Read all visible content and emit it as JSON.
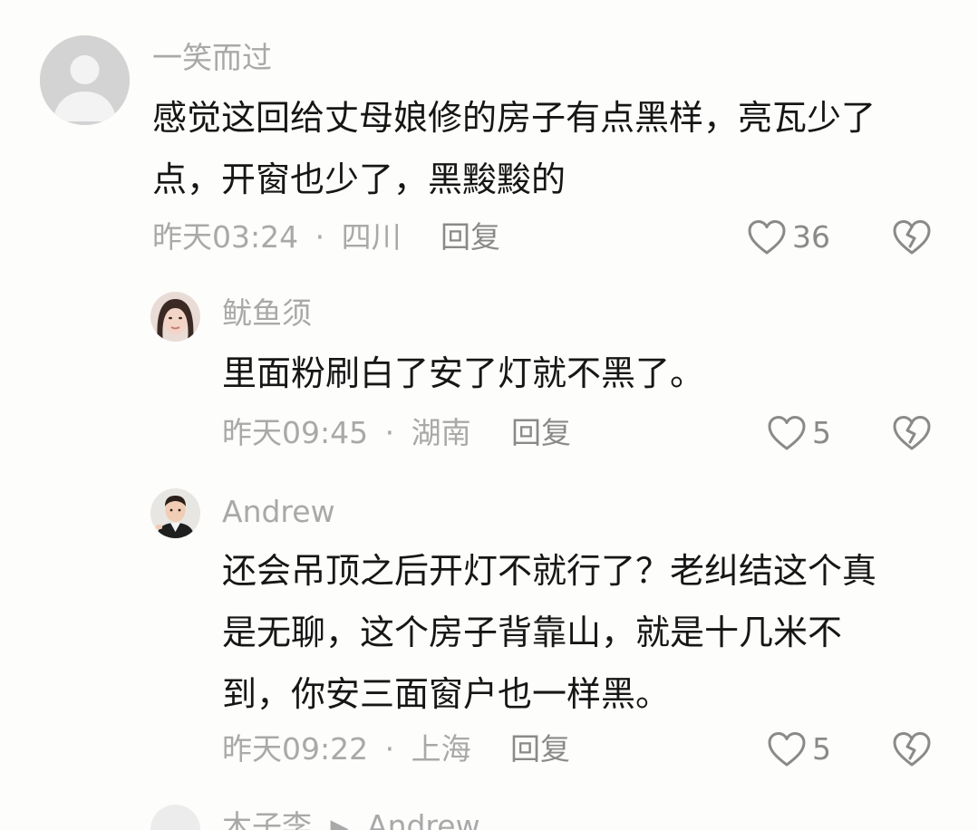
{
  "comments": [
    {
      "username": "一笑而过",
      "lines": [
        "感觉这回给丈母娘修的房子有点黑样，亮瓦少了",
        "点，开窗也少了，黑黢黢的"
      ],
      "time": "昨天03:24",
      "location": "四川",
      "reply_label": "回复",
      "likes": "36",
      "avatar_icon": "default-user-icon"
    },
    {
      "username": "鱿鱼须",
      "lines": [
        "里面粉刷白了安了灯就不黑了。"
      ],
      "time": "昨天09:45",
      "location": "湖南",
      "reply_label": "回复",
      "likes": "5",
      "avatar_icon": "profile-photo-woman"
    },
    {
      "username": "Andrew",
      "lines": [
        "还会吊顶之后开灯不就行了？老纠结这个真",
        "是无聊，这个房子背靠山，就是十几米不",
        "到，你安三面窗户也一样黑。"
      ],
      "time": "昨天09:22",
      "location": "上海",
      "reply_label": "回复",
      "likes": "5",
      "avatar_icon": "profile-photo-man"
    },
    {
      "username": "木子李",
      "reply_to": "Andrew",
      "avatar_icon": "profile-photo-partial"
    }
  ],
  "separator": "·",
  "colors": {
    "background": "#fdfdfb",
    "text": "#161616",
    "meta": "#a9a9a9",
    "action": "#8a8a8a"
  }
}
